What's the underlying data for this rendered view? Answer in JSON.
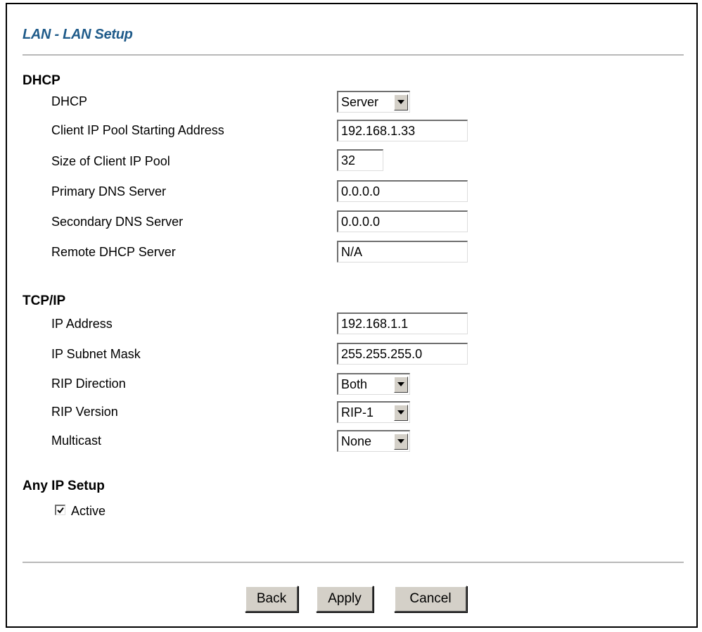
{
  "page": {
    "title": "LAN - LAN Setup"
  },
  "dhcp": {
    "heading": "DHCP",
    "mode_label": "DHCP",
    "mode_value": "Server",
    "pool_start_label": "Client IP Pool Starting Address",
    "pool_start_value": "192.168.1.33",
    "pool_size_label": "Size of Client IP Pool",
    "pool_size_value": "32",
    "primary_dns_label": "Primary DNS Server",
    "primary_dns_value": "0.0.0.0",
    "secondary_dns_label": "Secondary DNS Server",
    "secondary_dns_value": "0.0.0.0",
    "remote_dhcp_label": "Remote DHCP Server",
    "remote_dhcp_value": "N/A"
  },
  "tcpip": {
    "heading": "TCP/IP",
    "ip_label": "IP Address",
    "ip_value": "192.168.1.1",
    "mask_label": "IP Subnet Mask",
    "mask_value": "255.255.255.0",
    "rip_direction_label": "RIP Direction",
    "rip_direction_value": "Both",
    "rip_version_label": "RIP Version",
    "rip_version_value": "RIP-1",
    "multicast_label": "Multicast",
    "multicast_value": "None"
  },
  "any_ip": {
    "heading": "Any IP Setup",
    "active_label": "Active",
    "active_checked": true
  },
  "buttons": {
    "back": "Back",
    "apply": "Apply",
    "cancel": "Cancel"
  },
  "colors": {
    "title": "#1f5b8a",
    "rule": "#b8b8b8",
    "button_face": "#d4d0c8"
  }
}
